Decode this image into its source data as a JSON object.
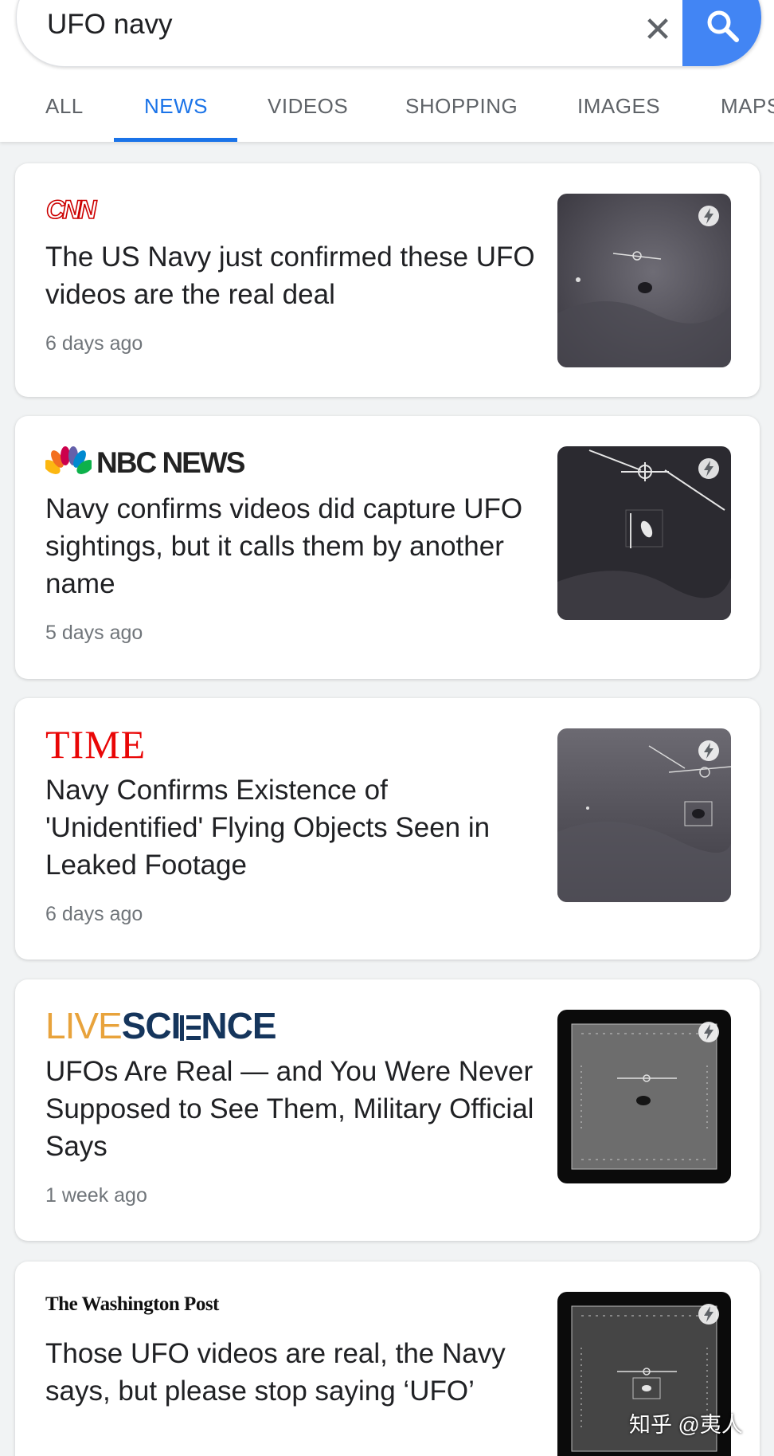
{
  "search": {
    "query": "UFO navy"
  },
  "tabs": [
    "ALL",
    "NEWS",
    "VIDEOS",
    "SHOPPING",
    "IMAGES",
    "MAPS"
  ],
  "results": [
    {
      "source": "CNN",
      "title": "The US Navy just confirmed these UFO videos are the real deal",
      "time": "6 days ago"
    },
    {
      "source": "NBC NEWS",
      "title": "Navy confirms videos did capture UFO sightings, but it calls them by another name",
      "time": "5 days ago"
    },
    {
      "source": "TIME",
      "title": "Navy Confirms Existence of 'Unidentified' Flying Objects Seen in Leaked Footage",
      "time": "6 days ago"
    },
    {
      "source_a": "LIVE",
      "source_b": "SCI",
      "source_c": "NCE",
      "title": "UFOs Are Real — and You Were Never Supposed to See Them, Military Official Says",
      "time": "1 week ago"
    },
    {
      "source": "The Washington Post",
      "title": "Those UFO videos are real, the Navy says, but please stop saying ‘UFO’",
      "time": ""
    }
  ],
  "watermark": "知乎 @夷人",
  "colors": {
    "accent": "#1a73e8",
    "search_button": "#4285f4",
    "cnn_red": "#cc0000",
    "time_red": "#e90606",
    "livescience_orange": "#e8a33c",
    "livescience_navy": "#15355c"
  }
}
